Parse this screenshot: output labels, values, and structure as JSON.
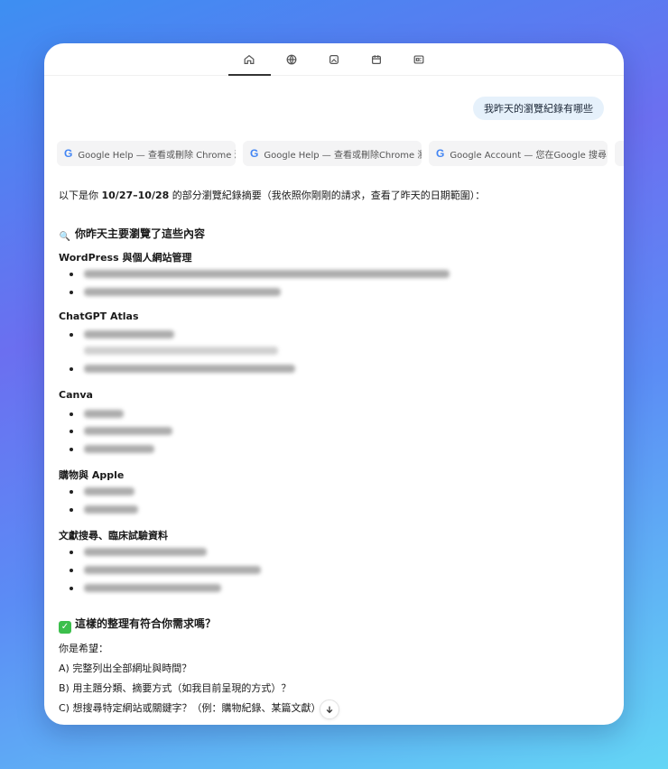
{
  "tabs": [
    {
      "icon": "home-icon",
      "active": true
    },
    {
      "icon": "globe-icon",
      "active": false
    },
    {
      "icon": "image-icon",
      "active": false
    },
    {
      "icon": "calendar-icon",
      "active": false
    },
    {
      "icon": "news-icon",
      "active": false
    }
  ],
  "user_message": "我昨天的瀏覽紀錄有哪些",
  "sources": [
    "Google Help — 查看或刪除 Chrome 瀏",
    "Google Help — 查看或刪除Chrome 瀏",
    "Google Account — 您在Google 搜尋中"
  ],
  "intro_prefix": "以下是你 ",
  "intro_dates": "10/27–10/28",
  "intro_suffix": " 的部分瀏覽紀錄摘要（我依照你剛剛的請求，查看了昨天的日期範圍）：",
  "section1_title": "你昨天主要瀏覽了這些內容",
  "groups": {
    "wordpress": "WordPress 與個人網站管理",
    "atlas": "ChatGPT Atlas",
    "canva": "Canva",
    "shopping": "購物與 Apple",
    "research": "文獻搜尋、臨床試驗資料"
  },
  "section2_title": "這樣的整理有符合你需求嗎？",
  "ask_lead": "你是希望：",
  "options": [
    "A) 完整列出全部網址與時間？",
    "B) 用主題分類、摘要方式（如我目前呈現的方式）？",
    "C) 想搜尋特定網站或關鍵字？（例：購物紀錄、某篇文獻）"
  ]
}
